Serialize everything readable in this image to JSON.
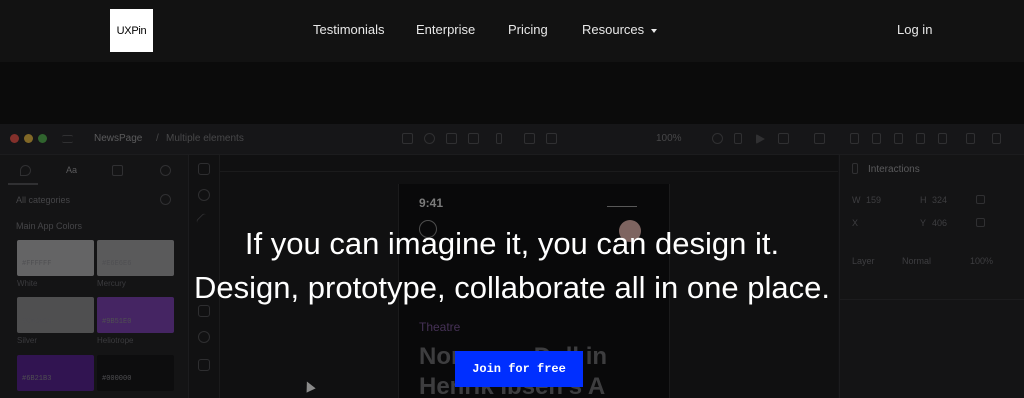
{
  "nav": {
    "logo": "UXPin",
    "links": [
      "Testimonials",
      "Enterprise",
      "Pricing",
      "Resources"
    ],
    "login": "Log in"
  },
  "hero": {
    "line1": "If you can imagine it, you can design it.",
    "line2": "Design, prototype, collaborate all in one place.",
    "cta": "Join for free"
  },
  "app_preview": {
    "breadcrumb_page": "NewsPage",
    "breadcrumb_sep": "/",
    "breadcrumb_item": "Multiple elements",
    "zoom": "100%",
    "left": {
      "tab_text": "Aa",
      "category": "All categories",
      "section": "Main App Colors",
      "swatches": [
        {
          "code": "#FFFFFF",
          "name": "White",
          "color": "#9a9a9c"
        },
        {
          "code": "#E6E6E6",
          "name": "Mercury",
          "color": "#8a8a8c"
        },
        {
          "code": "#CACACA",
          "name": "Silver",
          "color": "#7a7a7c"
        },
        {
          "code": "#9B51E0",
          "name": "Heliotrope",
          "color": "#6a3a99"
        },
        {
          "code": "#6B21B3",
          "name": "",
          "color": "#4c1f7d"
        },
        {
          "code": "#000000",
          "name": "",
          "color": "#141416"
        }
      ]
    },
    "right": {
      "interactions": "Interactions",
      "w_label": "W",
      "w_val": "159",
      "h_label": "H",
      "h_val": "324",
      "x_label": "X",
      "y_label": "Y",
      "y_val": "406",
      "layer": "Layer",
      "blend": "Normal",
      "opacity": "100%"
    },
    "phone": {
      "time": "9:41",
      "tag": "Theatre",
      "title": "Nora as a Doll in\nHenrik Ibsen's A"
    }
  }
}
